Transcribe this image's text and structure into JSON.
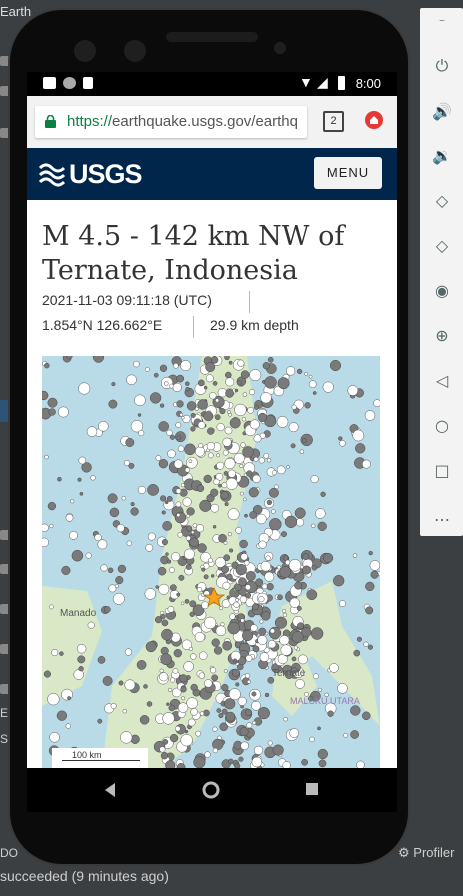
{
  "ide": {
    "title": "Earth",
    "status_text": "succeeded (9 minutes ago)",
    "profiler_label": "Profiler",
    "left_fragments": [
      "Ex",
      "Sc",
      "DO"
    ]
  },
  "phone": {
    "status": {
      "time": "8:00"
    },
    "browser": {
      "url_scheme": "https://",
      "url_rest": "earthquake.usgs.gov/earthq",
      "tab_count": "2"
    },
    "site": {
      "logo_text": "USGS",
      "menu_label": "MENU"
    },
    "event": {
      "title": "M 4.5 - 142 km NW of Ternate, Indonesia",
      "datetime": "2021-11-03 09:11:18 (UTC)",
      "coords": "1.854°N 126.662°E",
      "depth": "29.9 km depth"
    },
    "map": {
      "labels": {
        "manado": "Manado",
        "ternate": "Ternate",
        "maluku": "MALUKU UTARA"
      },
      "scale": "100 km",
      "colors": {
        "water": "#b9dbe8",
        "land": "#d9e8c6",
        "epicenter": "#f7a31d"
      }
    }
  },
  "colors": {
    "usgs_blue": "#00264c",
    "https_green": "#0b8043"
  }
}
